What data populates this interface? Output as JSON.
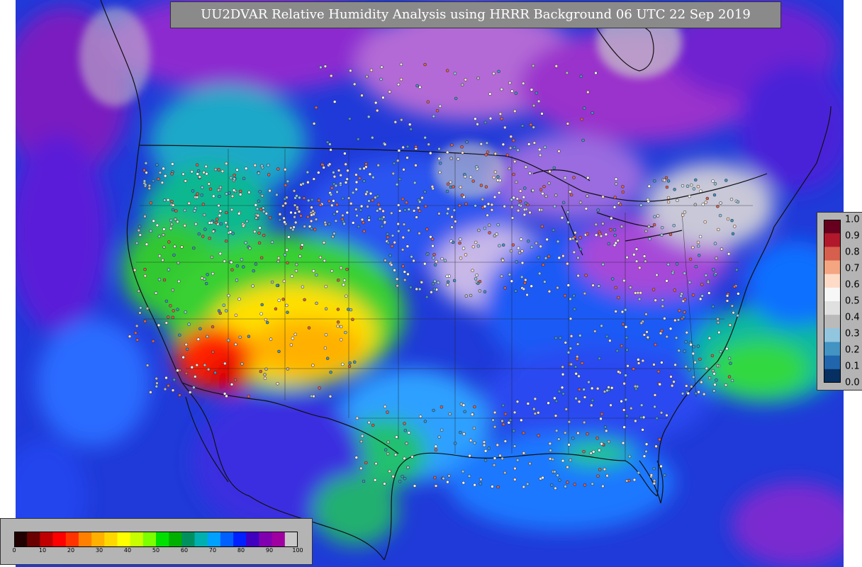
{
  "title": "UU2DVAR Relative Humidity Analysis using HRRR Background 06 UTC 22 Sep 2019",
  "rh_legend": {
    "ticks": [
      "0",
      "10",
      "20",
      "30",
      "40",
      "50",
      "60",
      "70",
      "80",
      "90",
      "100"
    ],
    "colors": [
      "#200000",
      "#6a0000",
      "#c00000",
      "#ff0000",
      "#ff3300",
      "#ff8000",
      "#ffb000",
      "#ffd700",
      "#ffff00",
      "#c8ff00",
      "#7cff00",
      "#00e000",
      "#00b000",
      "#009060",
      "#00b0b0",
      "#00a0ff",
      "#0060ff",
      "#0020ff",
      "#4000c0",
      "#8000b0",
      "#a000a0",
      "#c8c8c8"
    ]
  },
  "obs_legend": {
    "ticks": [
      "1.0",
      "0.9",
      "0.8",
      "0.7",
      "0.6",
      "0.5",
      "0.4",
      "0.3",
      "0.2",
      "0.1",
      "0.0"
    ],
    "colors": [
      "#67001f",
      "#b2182b",
      "#d6604d",
      "#f4a582",
      "#fddbc7",
      "#f7f7f7",
      "#e0e0e0",
      "#bababa",
      "#92c5de",
      "#4393c3",
      "#2166ac",
      "#053061"
    ]
  }
}
